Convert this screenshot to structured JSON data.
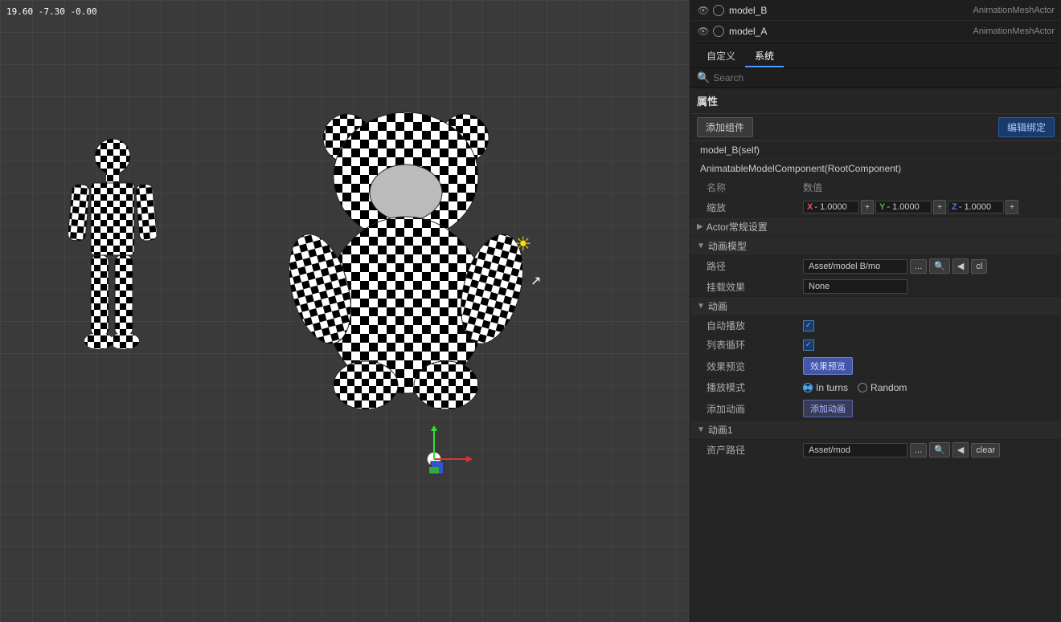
{
  "coords": "19.60  -7.30  -0.00",
  "outliner": {
    "rows": [
      {
        "name": "model_B",
        "type": "AnimationMeshActor"
      },
      {
        "name": "model_A",
        "type": "AnimationMeshActor"
      }
    ]
  },
  "tabs": {
    "custom": "自定义",
    "system": "系统"
  },
  "search": {
    "placeholder": "Search"
  },
  "properties": {
    "title": "属性",
    "add_component": "添加组件",
    "edit_bind": "编辑绑定",
    "component_self": "model_B(self)",
    "component_root": "AnimatableModelComponent(RootComponent)",
    "col_name": "名称",
    "col_value": "数值",
    "scale": {
      "label": "缩放",
      "x": "- 1.0000",
      "y": "- 1.0000",
      "z": "- 1.0000"
    },
    "actor_settings": {
      "label": "Actor常规设置",
      "collapsed": true
    },
    "animation_model": {
      "label": "动画模型",
      "path_label": "路径",
      "path_value": "Asset/model B/mo",
      "effect_label": "挂载效果",
      "effect_value": "None"
    },
    "animation": {
      "label": "动画",
      "auto_play_label": "自动播放",
      "auto_play_checked": true,
      "list_loop_label": "列表循环",
      "list_loop_checked": true,
      "effect_preview_label": "效果预览",
      "effect_preview_btn": "效果预览",
      "play_mode_label": "播放模式",
      "play_mode_in_turns": "In turns",
      "play_mode_random": "Random",
      "play_mode_selected": "in_turns",
      "add_animation_label": "添加动画",
      "add_animation_btn": "添加动画"
    },
    "animation1": {
      "label": "动画1",
      "asset_label": "资产路径",
      "asset_value": "Asset/mod"
    }
  }
}
